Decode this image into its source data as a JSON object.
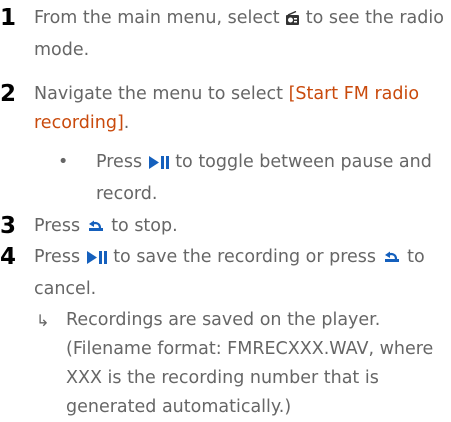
{
  "steps": [
    {
      "num": "1",
      "before": "From the main menu, select ",
      "after": " to see the radio mode.",
      "icon": "radio-icon"
    },
    {
      "num": "2",
      "before": "Navigate the menu to select ",
      "highlight": "[Start FM radio recording]",
      "after": "."
    },
    {
      "num": "3",
      "before": "Press ",
      "after": " to stop.",
      "icon": "back-icon"
    },
    {
      "num": "4",
      "before": "Press ",
      "mid": " to save the recording or press ",
      "after": " to cancel.",
      "icons": [
        "play-pause-icon",
        "back-icon"
      ]
    }
  ],
  "step2_sub": {
    "bullet": "•",
    "before": "Press ",
    "after": " to toggle between pause and record.",
    "icon": "play-pause-icon"
  },
  "step4_result": {
    "arrow": "↳",
    "text": "Recordings are saved on the player. (Filename format: FMRECXXX.WAV, where XXX is the recording number that is generated automatically.)"
  },
  "colors": {
    "accent": "#c94a0c",
    "body": "#666666",
    "number": "#000000"
  }
}
